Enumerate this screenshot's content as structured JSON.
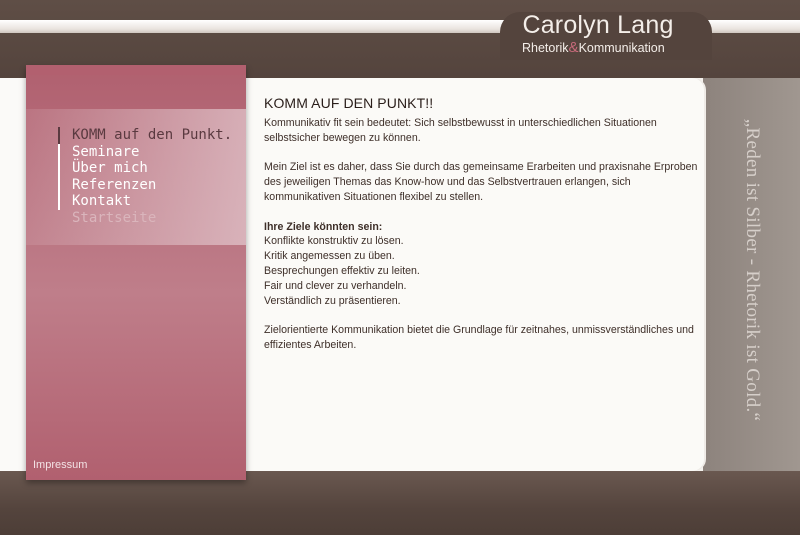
{
  "header": {
    "name": "Carolyn Lang",
    "tagline_left": "Rhetorik",
    "tagline_amp": "&",
    "tagline_right": "Kommunikation"
  },
  "nav": {
    "items": [
      {
        "label": "KOMM auf den Punkt.",
        "state": "active"
      },
      {
        "label": "Seminare",
        "state": "normal"
      },
      {
        "label": "Über mich",
        "state": "normal"
      },
      {
        "label": "Referenzen",
        "state": "normal"
      },
      {
        "label": "Kontakt",
        "state": "normal"
      },
      {
        "label": "Startseite",
        "state": "dim"
      }
    ]
  },
  "footer": {
    "impressum": "Impressum"
  },
  "main": {
    "title": "KOMM AUF DEN PUNKT!!",
    "intro": "Kommunikativ fit sein bedeutet: Sich selbstbewusst in unterschiedlichen Situationen selbstsicher bewegen zu können.",
    "goal": "Mein Ziel ist es daher, dass Sie durch das gemeinsame Erarbeiten und praxisnahe Erproben des jeweiligen Themas das Know-how und das  Selbstvertrauen erlangen, sich kommunikativen Situationen flexibel zu stellen.",
    "goals_heading": "Ihre Ziele könnten sein:",
    "goals": [
      "Konflikte konstruktiv zu lösen.",
      "Kritik angemessen zu üben.",
      "Besprechungen effektiv zu leiten.",
      "Fair und clever zu verhandeln.",
      "Verständlich zu präsentieren."
    ],
    "closing": "Zielorientierte Kommunikation bietet die Grundlage für zeitnahes, unmissverständliches und effizientes Arbeiten."
  },
  "quote": "„Reden ist Silber - Rhetorik ist Gold.“",
  "colors": {
    "brown": "#54443d",
    "rose": "#b0606f",
    "accent_amp": "#c86b7b",
    "quote_panel": "#9a918b",
    "card": "#fbfaf7"
  }
}
